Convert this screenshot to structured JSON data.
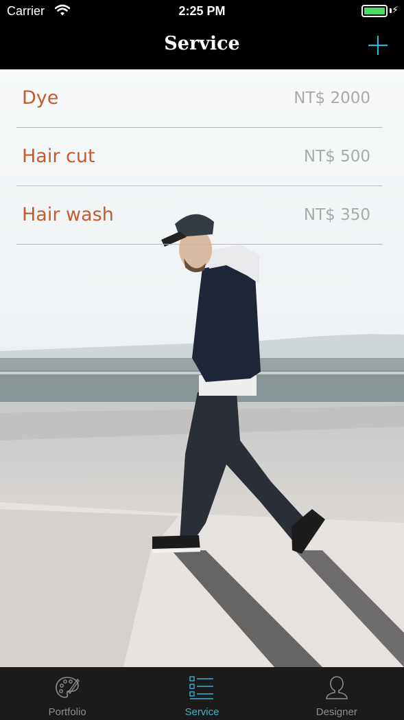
{
  "status_bar": {
    "carrier": "Carrier",
    "time": "2:25 PM",
    "battery_level": 1.0,
    "battery_color": "#4cd964",
    "wifi_icon": "wifi-icon",
    "charging_icon": "bolt-icon"
  },
  "nav": {
    "title": "Service",
    "add_icon": "plus-icon",
    "accent_color": "#3ab1d2"
  },
  "services": [
    {
      "name": "Dye",
      "price": "NT$ 2000"
    },
    {
      "name": "Hair cut",
      "price": "NT$ 500"
    },
    {
      "name": "Hair wash",
      "price": "NT$ 350"
    }
  ],
  "tabs": [
    {
      "label": "Portfolio",
      "icon": "palette-icon",
      "active": false
    },
    {
      "label": "Service",
      "icon": "list-icon",
      "active": true
    },
    {
      "label": "Designer",
      "icon": "person-icon",
      "active": false
    }
  ],
  "colors": {
    "service_name": "#c55a2c",
    "service_price": "#a9a9a9",
    "tab_active": "#3ab1d2",
    "tab_inactive": "#8e8e8e"
  }
}
